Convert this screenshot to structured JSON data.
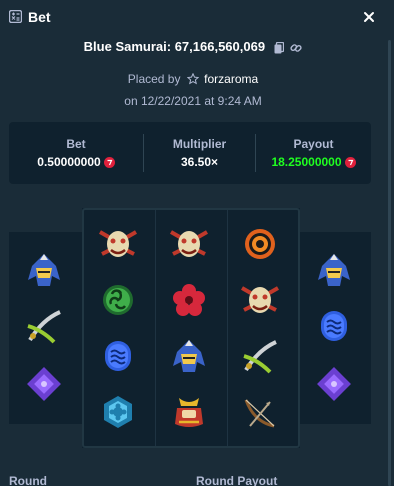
{
  "header": {
    "title": "Bet",
    "icon": "bet-slip-icon",
    "close_icon": "close-icon"
  },
  "game": {
    "title": "Blue Samurai: 67,166,560,069",
    "copy_icon": "copy-icon",
    "link_icon": "link-icon"
  },
  "placed": {
    "prefix": "Placed by",
    "star_icon": "star-icon",
    "user": "forzaroma",
    "date": "on 12/22/2021 at 9:24 AM"
  },
  "stats": {
    "bet": {
      "label": "Bet",
      "value": "0.50000000"
    },
    "multiplier": {
      "label": "Multiplier",
      "value": "36.50×"
    },
    "payout": {
      "label": "Payout",
      "value": "18.25000000"
    },
    "coin_icon": "currency-coin-icon",
    "payout_color": "#1fff20",
    "coin_color": "#e0203c"
  },
  "reels": [
    [
      "samurai-helmet-icon",
      "crossed-swords-icon",
      "purple-diamond-icon"
    ],
    [
      "oni-mask-icon",
      "green-swirl-icon",
      "blue-wave-icon",
      "cyan-crest-icon"
    ],
    [
      "oni-mask-icon",
      "red-flower-icon",
      "samurai-helmet-icon",
      "armor-helmet-icon"
    ],
    [
      "orange-circle-icon",
      "oni-mask-icon",
      "crossed-swords-icon",
      "bow-icon"
    ],
    [
      "samurai-helmet-icon",
      "blue-wave-icon",
      "purple-diamond-icon"
    ]
  ],
  "footer": {
    "round_label": "Round",
    "round_payout_label": "Round Payout"
  }
}
